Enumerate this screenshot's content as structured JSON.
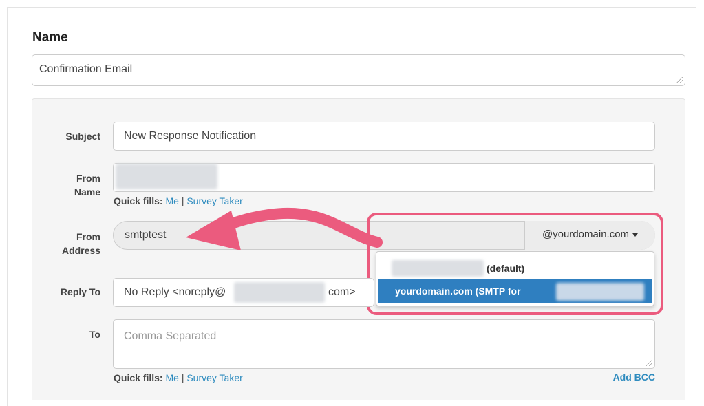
{
  "name_section": {
    "label": "Name",
    "value": "Confirmation Email"
  },
  "subject": {
    "label": "Subject",
    "value": "New Response Notification"
  },
  "from_name": {
    "label_line1": "From",
    "label_line2": "Name",
    "value": ""
  },
  "quick_fills": {
    "label": "Quick fills:",
    "me": "Me",
    "separator": "|",
    "survey_taker": "Survey Taker"
  },
  "from_address": {
    "label_line1": "From",
    "label_line2": "Address",
    "value": "smtptest",
    "domain_button": "@yourdomain.com"
  },
  "domain_dropdown": {
    "option_default_suffix": "(default)",
    "option_selected": "yourdomain.com (SMTP for"
  },
  "reply_to": {
    "label": "Reply To",
    "value_prefix": "No Reply <noreply@",
    "value_suffix": "com>"
  },
  "to": {
    "label": "To",
    "placeholder": "Comma Separated"
  },
  "add_bcc": "Add BCC",
  "colors": {
    "accent_pink": "#eb5b7e",
    "link_blue": "#2f8cbf",
    "selected_blue": "#2f7fc0"
  }
}
